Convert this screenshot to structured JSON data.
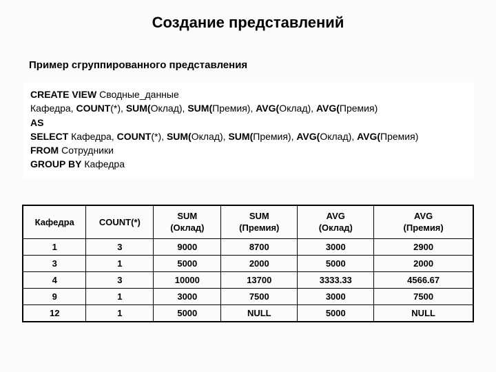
{
  "title": "Создание представлений",
  "subtitle": "Пример сгруппированного представления",
  "code": {
    "l1a": "CREATE VIEW",
    "l1b": " Сводные_данные",
    "l2a": "Кафедра, ",
    "l2b": "COUNT",
    "l2c": "(*), ",
    "l2d": "SUM(",
    "l2e": "Оклад), ",
    "l2f": "SUM(",
    "l2g": "Премия), ",
    "l2h": "AVG(",
    "l2i": "Оклад), ",
    "l2j": "AVG(",
    "l2k": "Премия)",
    "l3": "AS",
    "l4a": "SELECT",
    "l4b": " Кафедра, ",
    "l4c": "COUNT",
    "l4d": "(*), ",
    "l4e": "SUM(",
    "l4f": "Оклад), ",
    "l4g": "SUM(",
    "l4h": "Премия), ",
    "l4i": "AVG(",
    "l4j": "Оклад), ",
    "l4k": "AVG(",
    "l4l": "Премия)",
    "l5a": "FROM",
    "l5b": " Сотрудники",
    "l6a": "GROUP BY",
    "l6b": " Кафедра"
  },
  "table": {
    "headers": {
      "c1": "Кафедра",
      "c2": "COUNT(*)",
      "c3a": "SUM",
      "c3b": "(Оклад)",
      "c4a": "SUM",
      "c4b": "(Премия)",
      "c5a": "AVG",
      "c5b": "(Оклад)",
      "c6a": "AVG",
      "c6b": "(Премия)"
    },
    "rows": [
      {
        "c1": "1",
        "c2": "3",
        "c3": "9000",
        "c4": "8700",
        "c5": "3000",
        "c6": "2900"
      },
      {
        "c1": "3",
        "c2": "1",
        "c3": "5000",
        "c4": "2000",
        "c5": "5000",
        "c6": "2000"
      },
      {
        "c1": "4",
        "c2": "3",
        "c3": "10000",
        "c4": "13700",
        "c5": "3333.33",
        "c6": "4566.67"
      },
      {
        "c1": "9",
        "c2": "1",
        "c3": "3000",
        "c4": "7500",
        "c5": "3000",
        "c6": "7500"
      },
      {
        "c1": "12",
        "c2": "1",
        "c3": "5000",
        "c4": "NULL",
        "c5": "5000",
        "c6": "NULL"
      }
    ]
  },
  "chart_data": {
    "type": "table",
    "title": "Сводные_данные",
    "columns": [
      "Кафедра",
      "COUNT(*)",
      "SUM(Оклад)",
      "SUM(Премия)",
      "AVG(Оклад)",
      "AVG(Премия)"
    ],
    "rows": [
      [
        1,
        3,
        9000,
        8700,
        3000,
        2900
      ],
      [
        3,
        1,
        5000,
        2000,
        5000,
        2000
      ],
      [
        4,
        3,
        10000,
        13700,
        3333.33,
        4566.67
      ],
      [
        9,
        1,
        3000,
        7500,
        3000,
        7500
      ],
      [
        12,
        1,
        5000,
        null,
        5000,
        null
      ]
    ]
  }
}
